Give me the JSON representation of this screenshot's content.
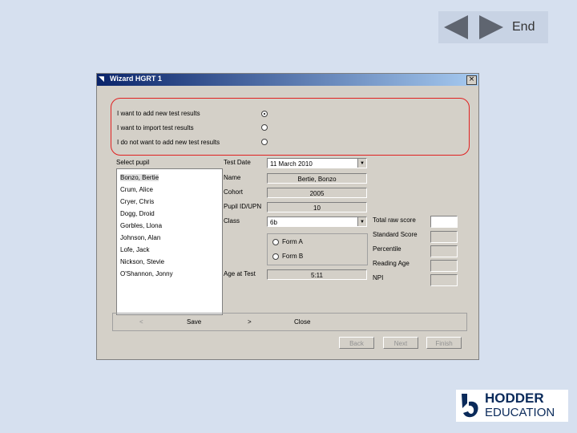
{
  "nav": {
    "end_label": "End"
  },
  "dialog": {
    "title": "Wizard HGRT 1",
    "close_symbol": "×",
    "options": [
      {
        "label": "I want to add new test results",
        "selected": true
      },
      {
        "label": "I want to import test results",
        "selected": false
      },
      {
        "label": "I do not want to add new test results",
        "selected": false
      }
    ],
    "select_pupil_label": "Select pupil",
    "pupils": [
      {
        "name": "Bonzo, Bertie",
        "selected": true
      },
      {
        "name": "Crum, Alice",
        "selected": false
      },
      {
        "name": "Cryer, Chris",
        "selected": false
      },
      {
        "name": "Dogg, Droid",
        "selected": false
      },
      {
        "name": "Gorbles, Llona",
        "selected": false
      },
      {
        "name": "Johnson, Alan",
        "selected": false
      },
      {
        "name": "Lofe, Jack",
        "selected": false
      },
      {
        "name": "Nickson, Stevie",
        "selected": false
      },
      {
        "name": "O'Shannon, Jonny",
        "selected": false
      }
    ],
    "fields": {
      "test_date_label": "Test Date",
      "test_date_value": "11   March   2010",
      "name_label": "Name",
      "name_value": "Bertie, Bonzo",
      "cohort_label": "Cohort",
      "cohort_value": "2005",
      "upn_label": "Pupil ID/UPN",
      "upn_value": "10",
      "class_label": "Class",
      "class_value": "6b",
      "age_label": "Age at Test",
      "age_value": "5:11"
    },
    "forms": [
      {
        "label": "Form A",
        "selected": false
      },
      {
        "label": "Form B",
        "selected": false
      }
    ],
    "scores": [
      {
        "label": "Total raw score",
        "white": true
      },
      {
        "label": "Standard Score",
        "white": false
      },
      {
        "label": "Percentile",
        "white": false
      },
      {
        "label": "Reading Age",
        "white": false
      },
      {
        "label": "NPI",
        "white": false
      }
    ],
    "strip": {
      "prev": "<",
      "save": "Save",
      "next": ">",
      "close": "Close"
    },
    "buttons": {
      "back": "Back",
      "next": "Next",
      "finish": "Finish"
    }
  },
  "logo": {
    "line1": "HODDER",
    "line2": "EDUCATION"
  }
}
